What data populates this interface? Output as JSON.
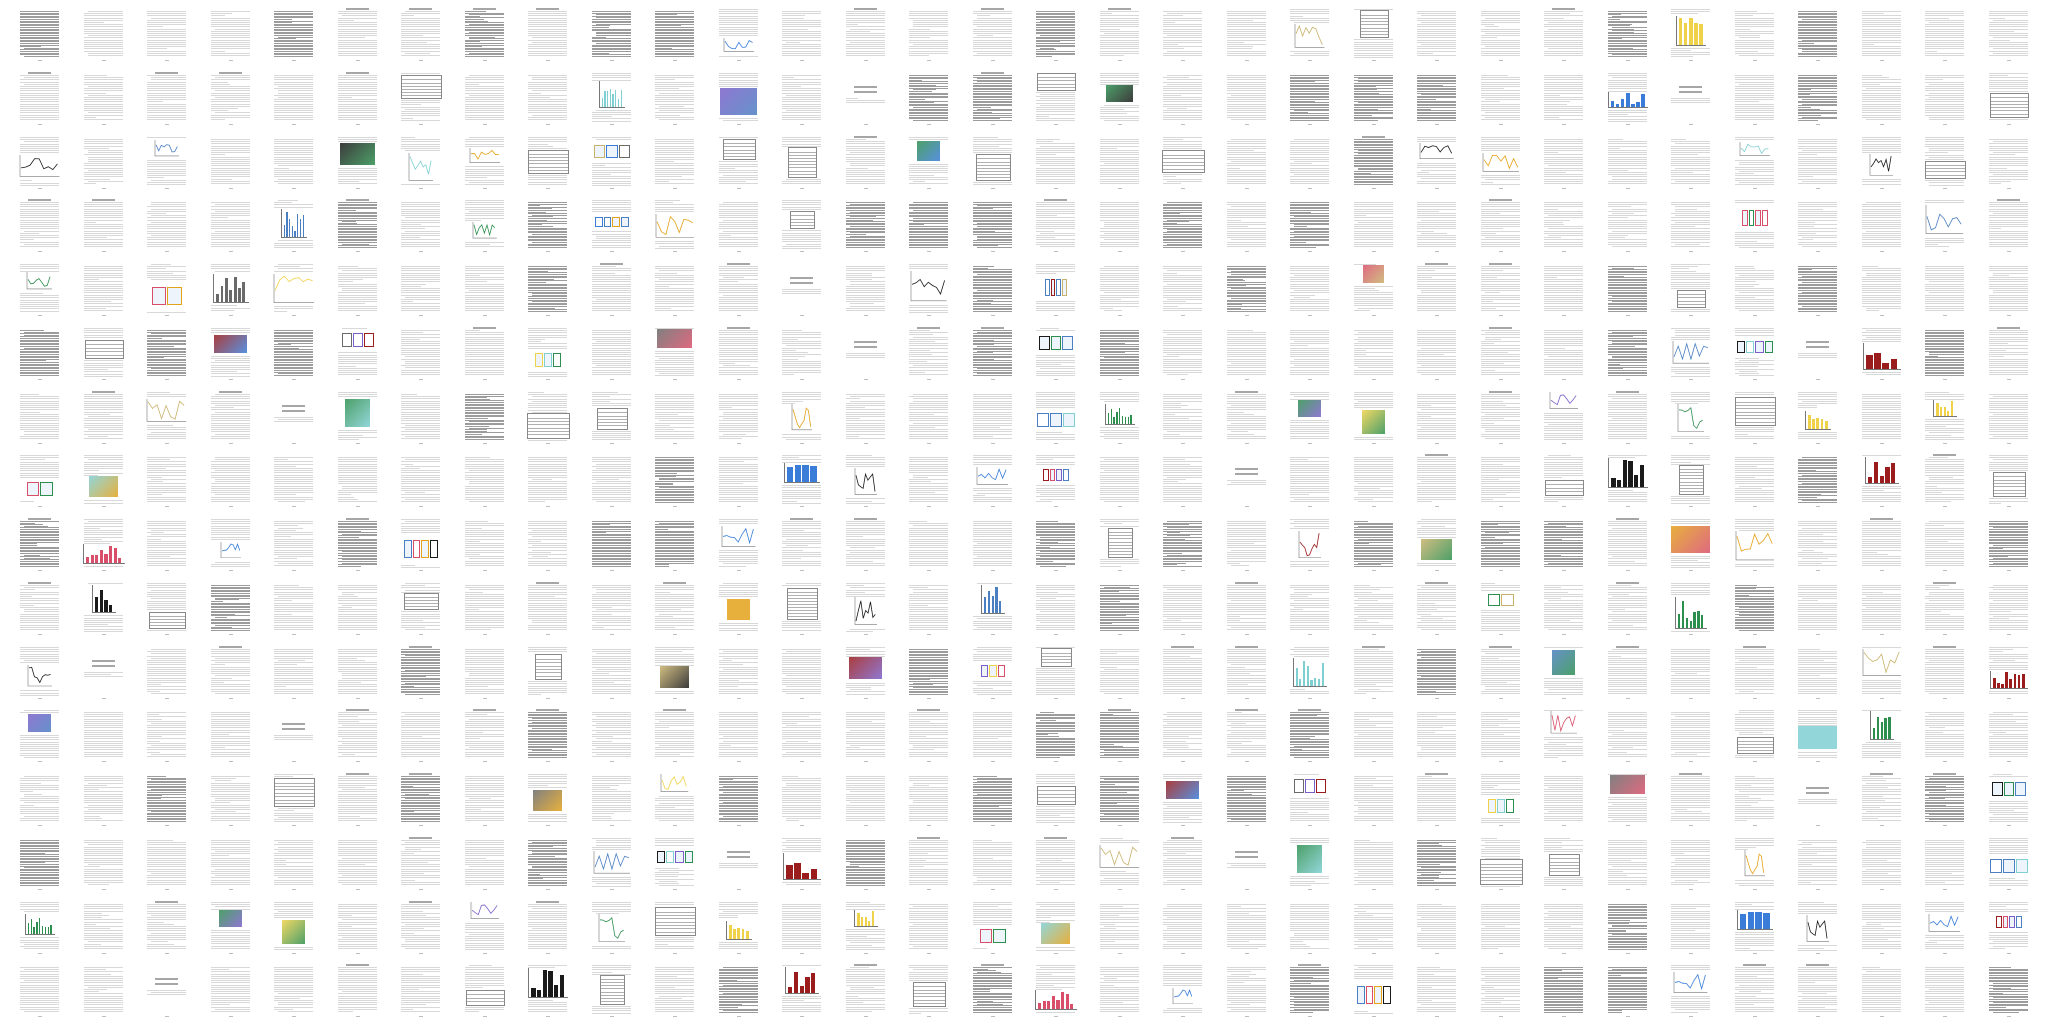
{
  "view": {
    "title": "",
    "rows": 16,
    "cols": 32,
    "pages_shown": 512
  },
  "palette": {
    "background": "#ffffff",
    "text_gray": "#a9a9a9",
    "text_dark": "#4a4a4a",
    "heading": "#6a6a6a",
    "figure_accents": [
      "#e3a21a",
      "#4a7fc1",
      "#7b5fc9",
      "#9b1c1c",
      "#2d8f4e",
      "#d94f6a",
      "#3a7dd8",
      "#1a1a1a",
      "#c9b26b",
      "#6a6a6a",
      "#7fcfd3",
      "#f0d24a"
    ]
  },
  "thumbnail_kinds": [
    "text",
    "dense-text",
    "figure",
    "table",
    "chart-bar",
    "chart-line",
    "photo",
    "cover"
  ]
}
